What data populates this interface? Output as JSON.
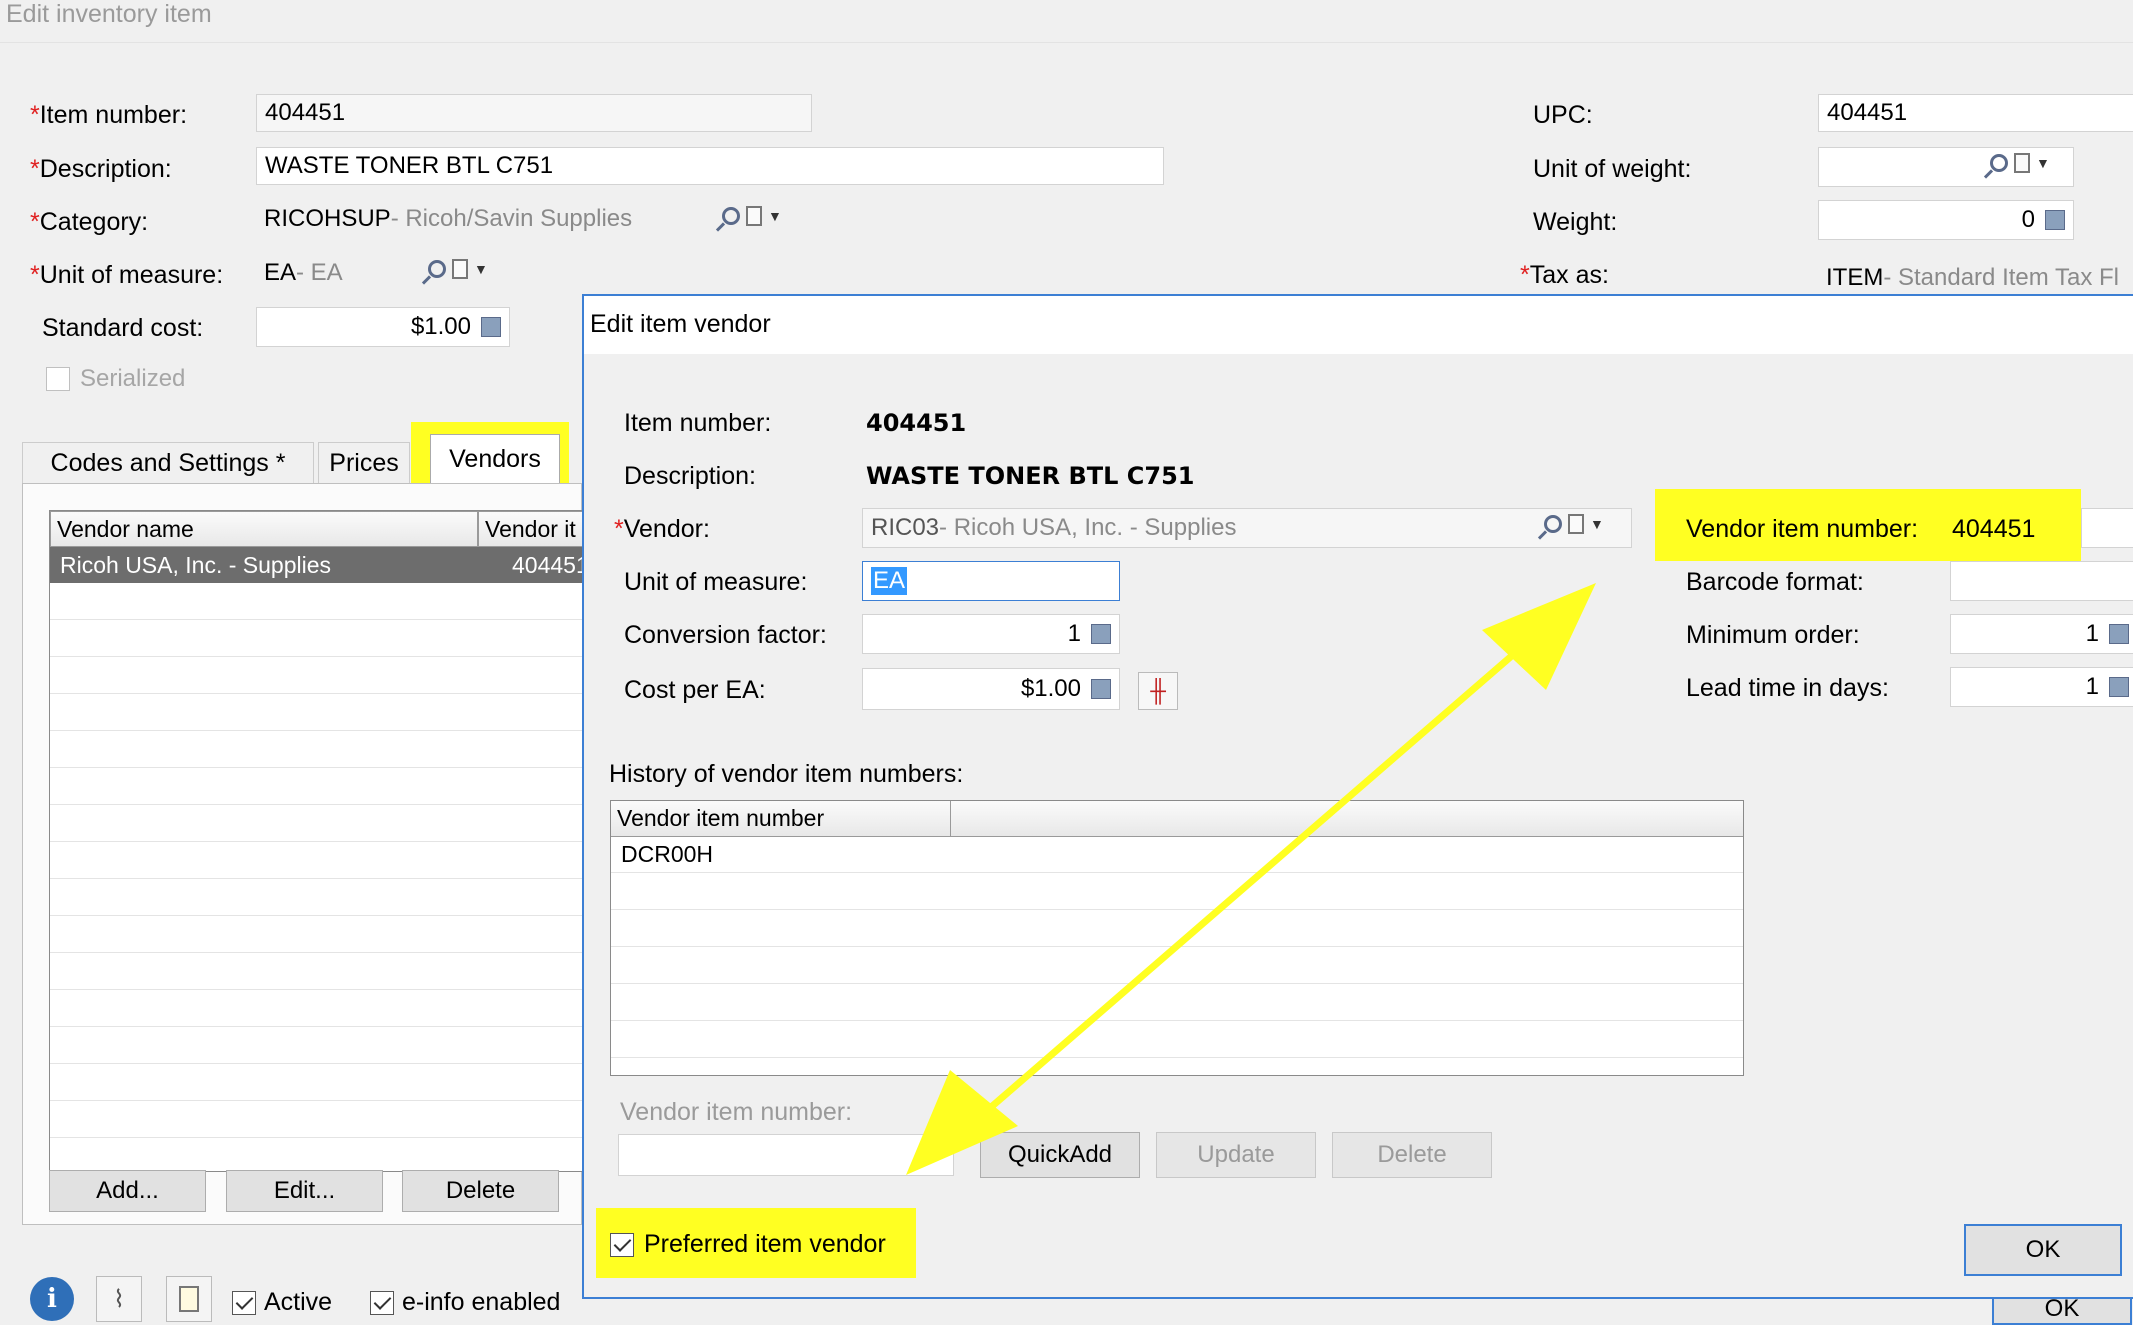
{
  "window": {
    "title": "Edit inventory item"
  },
  "main_form": {
    "item_number": {
      "label": "Item number:",
      "value": "404451"
    },
    "description": {
      "label": "Description:",
      "value": "WASTE TONER BTL C751"
    },
    "category": {
      "label": "Category:",
      "code": "RICOHSUP",
      "name": " - Ricoh/Savin Supplies"
    },
    "unit_of_measure": {
      "label": "Unit of measure:",
      "code": "EA",
      "name": " - EA"
    },
    "standard_cost": {
      "label": "Standard cost:",
      "value": "$1.00"
    },
    "serialized": {
      "label": "Serialized",
      "checked": false
    },
    "upc": {
      "label": "UPC:",
      "value": "404451"
    },
    "unit_of_weight": {
      "label": "Unit of weight:",
      "value": ""
    },
    "weight": {
      "label": "Weight:",
      "value": "0"
    },
    "tax_as": {
      "label": "Tax as:",
      "code": "ITEM",
      "name": " - Standard Item Tax Fl"
    }
  },
  "tabs": [
    {
      "label": "Codes and Settings *",
      "active": false
    },
    {
      "label": "Prices",
      "active": false
    },
    {
      "label": "Vendors",
      "active": true
    }
  ],
  "vendor_grid": {
    "columns": [
      "Vendor name",
      "Vendor it"
    ],
    "rows": [
      {
        "vendor_name": "Ricoh USA, Inc. - Supplies",
        "vendor_item": "404451"
      }
    ]
  },
  "grid_buttons": {
    "add": "Add...",
    "edit": "Edit...",
    "delete": "Delete"
  },
  "footer": {
    "active": {
      "label": "Active",
      "checked": true
    },
    "einfo": {
      "label": "e-info enabled",
      "checked": true
    },
    "ok": "OK"
  },
  "dialog": {
    "title": "Edit item vendor",
    "item_number": {
      "label": "Item number:",
      "value": "404451"
    },
    "description": {
      "label": "Description:",
      "value": "WASTE TONER BTL C751"
    },
    "vendor": {
      "label": "Vendor:",
      "code": "RIC03",
      "name": " - Ricoh USA, Inc. - Supplies"
    },
    "unit_of_measure": {
      "label": "Unit of measure:",
      "value": "EA"
    },
    "conversion_factor": {
      "label": "Conversion factor:",
      "value": "1"
    },
    "cost_per": {
      "label": "Cost per EA:",
      "value": "$1.00"
    },
    "vendor_item_number": {
      "label": "Vendor item number:",
      "value": "404451"
    },
    "barcode_format": {
      "label": "Barcode format:",
      "value": ""
    },
    "minimum_order": {
      "label": "Minimum order:",
      "value": "1"
    },
    "lead_time": {
      "label": "Lead time in days:",
      "value": "1"
    },
    "history": {
      "label": "History of vendor item numbers:",
      "columns": [
        "Vendor item number",
        ""
      ],
      "rows": [
        "DCR00H"
      ]
    },
    "vendor_item_input": {
      "label": "Vendor item number:",
      "value": ""
    },
    "buttons": {
      "quickadd": "QuickAdd",
      "update": "Update",
      "delete": "Delete",
      "ok": "OK"
    },
    "preferred": {
      "label": "Preferred item vendor",
      "checked": true
    }
  },
  "colors": {
    "highlight": "#ffff22",
    "required": "#e02020",
    "dialog_border": "#3c7fd4",
    "selection": "#6d6d6d"
  }
}
